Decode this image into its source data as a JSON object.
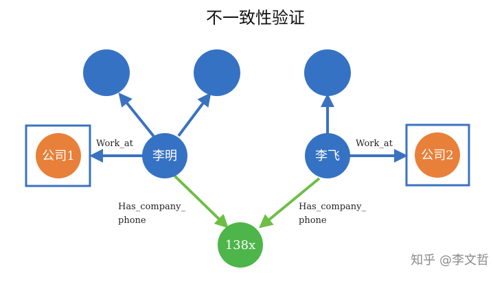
{
  "title": "不一致性验证",
  "colors": {
    "person": "#3672C4",
    "company": "#E8803A",
    "phone": "#4DB54A",
    "edge_blue": "#3A72C0",
    "edge_green": "#6DBE45",
    "box_border": "#3A72C0"
  },
  "nodes": {
    "person_left": "李明",
    "person_right": "李飞",
    "company_left": "公司1",
    "company_right": "公司2",
    "phone": "138x"
  },
  "edges": {
    "work_left": "Work_at",
    "work_right": "Work_at",
    "phone_left_line1": "Has_company_",
    "phone_left_line2": "phone",
    "phone_right_line1": "Has_company_",
    "phone_right_line2": "phone"
  },
  "watermark": "知乎 @李文哲"
}
